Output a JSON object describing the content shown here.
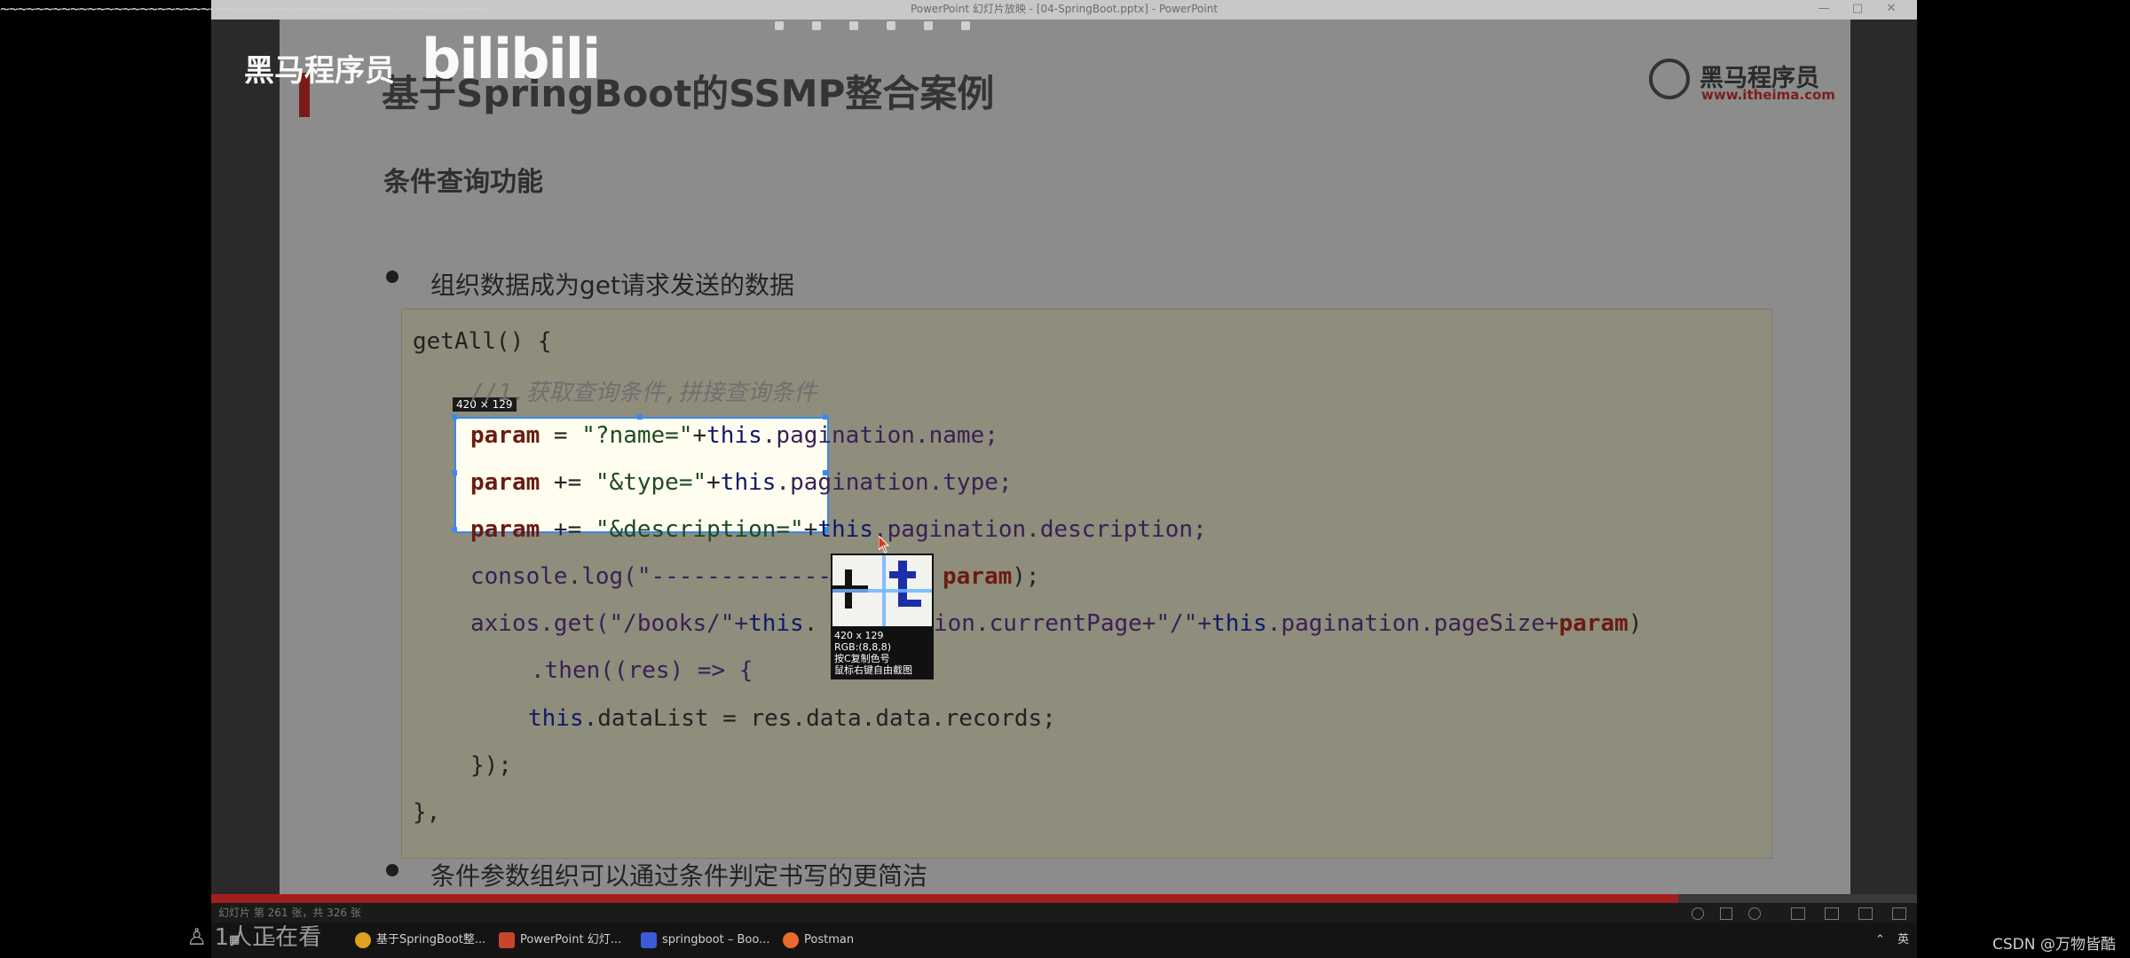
{
  "window": {
    "title": "PowerPoint 幻灯片放映 - [04-SpringBoot.pptx] - PowerPoint",
    "wavy": "~~~~~~~~~~~~~~~~~~~~~~~~~~~~~~~~~~~~~~~~~~~~~~~~~~~~~~~~",
    "minimize": "—",
    "maximize": "□",
    "close": "✕"
  },
  "overlay": {
    "heima": "黑马程序员",
    "bilibili": "bilibili",
    "viewers": "1人正在看",
    "csdn": "CSDN @万物皆酷"
  },
  "slide": {
    "title": "基于SpringBoot的SSMP整合案例",
    "subtitle": "条件查询功能",
    "bullet1": "组织数据成为get请求发送的数据",
    "bullet2": "条件参数组织可以通过条件判定书写的更简洁",
    "logo_text": "黑马程序员",
    "logo_url": "www.itheima.com"
  },
  "code": {
    "l1": "getAll() {",
    "l2": "//1.获取查询条件,拼接查询条件",
    "l3_a": "param",
    "l3_b": " = ",
    "l3_c": "\"?name=\"",
    "l3_d": "+",
    "l3_e": "this",
    "l3_f": ".pagination.name;",
    "l4_a": "param",
    "l4_b": " += ",
    "l4_c": "\"&type=\"",
    "l4_d": "+",
    "l4_e": "this",
    "l4_f": ".pagination.type;",
    "l5_a": "param",
    "l5_b": " += ",
    "l5_c": "\"&description=\"",
    "l5_d": "+",
    "l5_e": "this",
    "l5_f": ".pagination.description;",
    "l6_a": "console.log(\"-------------",
    "l6_b": "param",
    "l6_c": ");",
    "l7_a": "axios.get(\"/books/\"+",
    "l7_b": "this",
    "l7_c": ".",
    "l7_d": "ion.currentPage+\"/\"+",
    "l7_e": "this",
    "l7_f": ".pagination.pageSize+",
    "l7_g": "param",
    "l7_h": ")",
    "l8": ".then((res) => {",
    "l9_a": "this",
    "l9_b": ".dataList = res.data.data.records;",
    "l10": "});",
    "l11": "},"
  },
  "screenshot_tool": {
    "size_badge": "420 × 129",
    "info_size": "420 x 129",
    "info_rgb": "RGB:(8,8,8)",
    "info_copy": "按C复制色号",
    "info_right": "鼠标右键自由截图"
  },
  "status": {
    "text": "幻灯片 第 261 张，共 326 张",
    "progress": 0.86
  },
  "taskbar": {
    "items": [
      {
        "label": "基于SpringBoot整...",
        "color": "#e0a020"
      },
      {
        "label": "PowerPoint 幻灯...",
        "color": "#c8452c"
      },
      {
        "label": "springboot – Boo...",
        "color": "#3b5bd8"
      },
      {
        "label": "Postman",
        "color": "#e86a2c"
      }
    ],
    "lang": "英"
  }
}
